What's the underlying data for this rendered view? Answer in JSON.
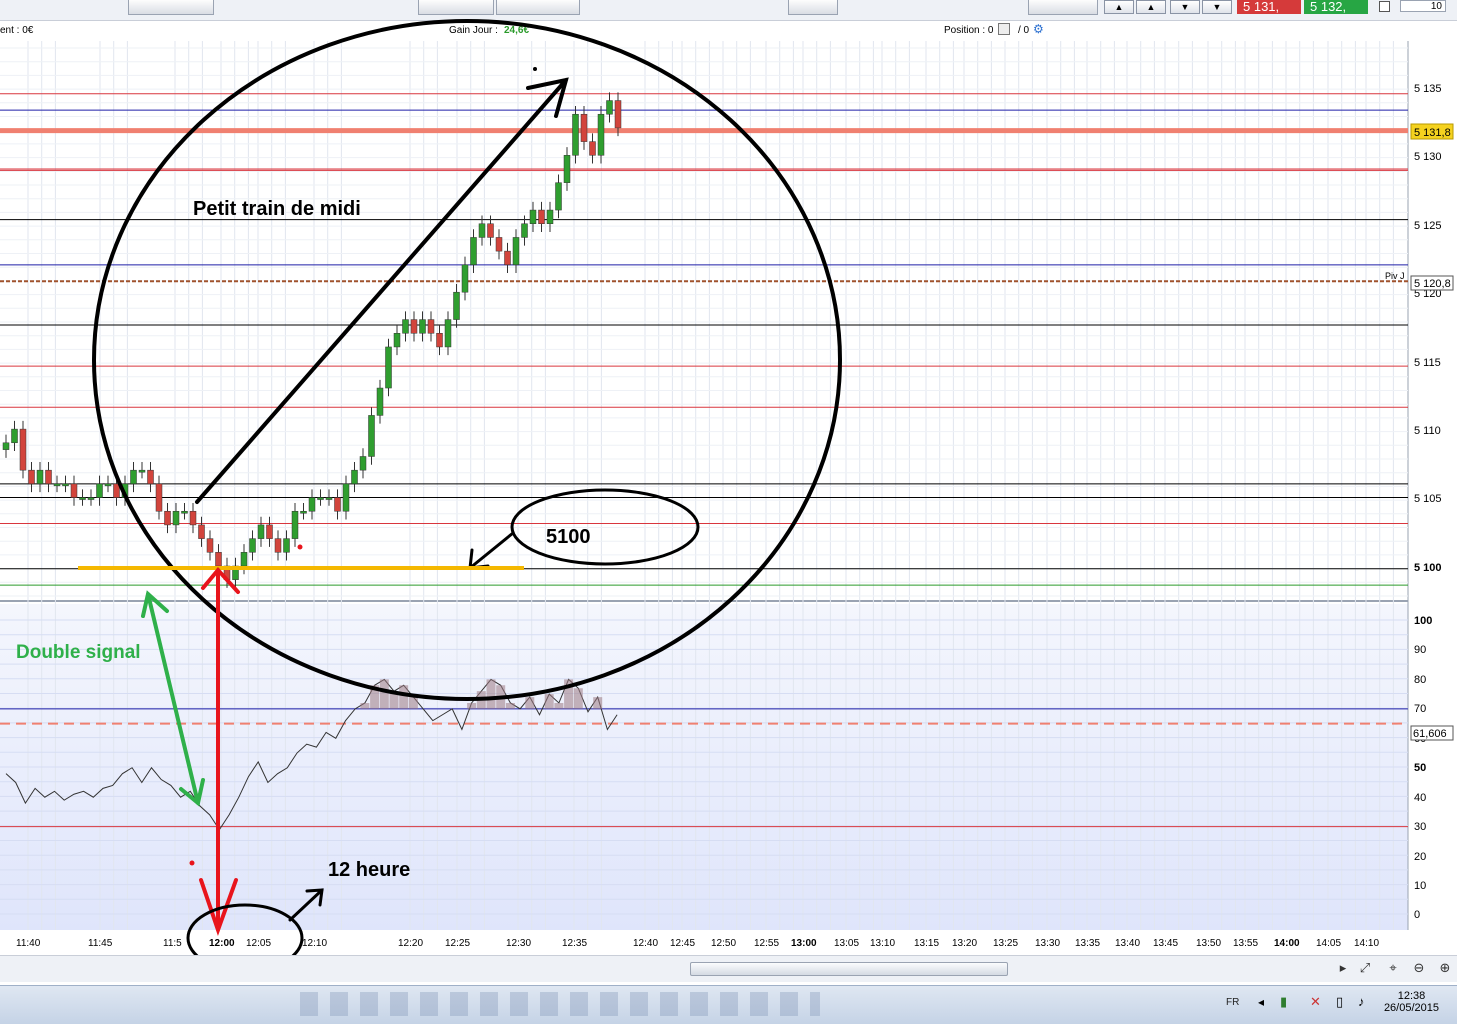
{
  "infobar": {
    "account_label": "ent : 0€",
    "gain_label": "Gain Jour :",
    "gain_value": "24,6€",
    "position_label": "Position : 0",
    "position_value": "/ 0"
  },
  "toolbar": {
    "sell_price": "5 131,",
    "buy_price": "5 132,",
    "quantity": "10"
  },
  "price_axis": {
    "ticks": [
      "5 135",
      "5 130",
      "5 125",
      "5 120",
      "5 115",
      "5 110",
      "5 105",
      "5 100"
    ],
    "current_price_tag": "5 131,8",
    "pivot_label": "Piv J",
    "pivot_value": "5 120,8"
  },
  "indicator_axis": {
    "ticks": [
      "100",
      "90",
      "80",
      "70",
      "60",
      "50",
      "40",
      "30",
      "20",
      "10",
      "0"
    ],
    "current_value_tag": "61,606"
  },
  "time_axis": {
    "labels": [
      "11:40",
      "11:45",
      "11:5",
      "12:00",
      "12:05",
      "12:10",
      "12:20",
      "12:25",
      "12:30",
      "12:35",
      "12:40",
      "12:45",
      "12:50",
      "12:55",
      "13:00",
      "13:05",
      "13:10",
      "13:15",
      "13:20",
      "13:25",
      "13:30",
      "13:35",
      "13:40",
      "13:45",
      "13:50",
      "13:55",
      "14:00",
      "14:05",
      "14:10"
    ]
  },
  "annotations": {
    "title": "Petit train de midi",
    "level_note": "5100",
    "signal_note": "Double signal",
    "hour_note": "12 heure"
  },
  "taskbar": {
    "lang": "FR",
    "time": "12:38",
    "date": "26/05/2015"
  },
  "colors": {
    "candle_up": "#2f9e2f",
    "candle_down": "#d2443c",
    "level_red": "#d9363e",
    "level_blue": "#1f1fa8",
    "level_orange": "#f08070",
    "support_yellow": "#f5b800",
    "annotation_black": "#000000",
    "annotation_red": "#e8141c",
    "annotation_green": "#2fb04a"
  }
}
